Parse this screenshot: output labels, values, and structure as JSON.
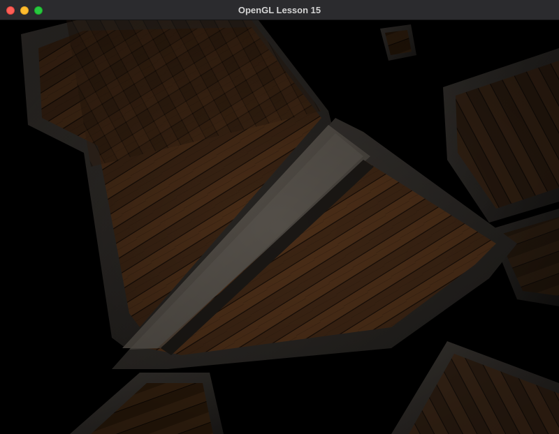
{
  "window": {
    "title": "OpenGL Lesson 15"
  },
  "colors": {
    "titlebar": "#2b2b2e",
    "close": "#ff5f57",
    "minimize": "#febc2e",
    "zoom": "#28c840",
    "wood_dark": "#2a1a0e",
    "wood_mid": "#4a2f18",
    "frame_gray": "#4a4540"
  },
  "scene": {
    "description_icon": "wooden-crate-texture",
    "crate_count": 6
  }
}
